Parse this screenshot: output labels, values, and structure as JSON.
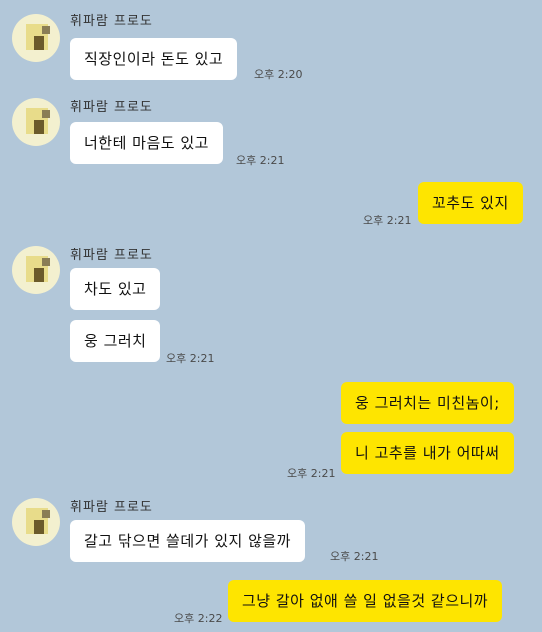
{
  "colors": {
    "background": "#b2c7d9",
    "incoming_bubble": "#ffffff",
    "outgoing_bubble": "#fee500"
  },
  "sender_name": "휘파람 프로도",
  "messages": [
    {
      "direction": "in",
      "text": "직장인이라 돈도 있고",
      "time": "오후 2:20"
    },
    {
      "direction": "in",
      "text": "너한테 마음도 있고",
      "time": "오후 2:21"
    },
    {
      "direction": "out",
      "text": "꼬추도 있지",
      "time": "오후 2:21"
    },
    {
      "direction": "in",
      "text": "차도 있고",
      "time": ""
    },
    {
      "direction": "in",
      "text": "웅 그러치",
      "time": "오후 2:21"
    },
    {
      "direction": "out",
      "text": "웅 그러치는 미친놈이;",
      "time": ""
    },
    {
      "direction": "out",
      "text": "니 고추를 내가 어따써",
      "time": "오후 2:21"
    },
    {
      "direction": "in",
      "text": "갈고 닦으면 쓸데가 있지 않을까",
      "time": "오후 2:21"
    },
    {
      "direction": "out",
      "text": "그냥 갈아 없애 쓸 일 없을것 같으니까",
      "time": "오후 2:22"
    }
  ],
  "avatar_icon": "blurred-profile-picture"
}
